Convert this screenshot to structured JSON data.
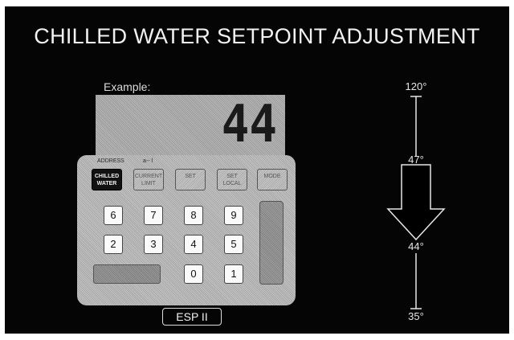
{
  "title": "CHILLED WATER SETPOINT ADJUSTMENT",
  "example": {
    "label": "Example:",
    "display_value": "44"
  },
  "keypad": {
    "address_text": "ADDRESS",
    "address_text2": "a-- l",
    "function_keys": [
      {
        "label": "CHILLED WATER",
        "active": true
      },
      {
        "label": "CURRENT LIMIT",
        "active": false
      },
      {
        "label": "SET",
        "active": false
      },
      {
        "label": "SET LOCAL",
        "active": false
      },
      {
        "label": "MODE",
        "active": false
      }
    ],
    "number_keys": [
      "6",
      "7",
      "8",
      "9",
      "2",
      "3",
      "4",
      "5",
      "0",
      "1"
    ]
  },
  "brand": "ESP II",
  "scale": {
    "top": "120°",
    "upper": "47°",
    "setpoint": "44°",
    "bottom": "35°"
  }
}
